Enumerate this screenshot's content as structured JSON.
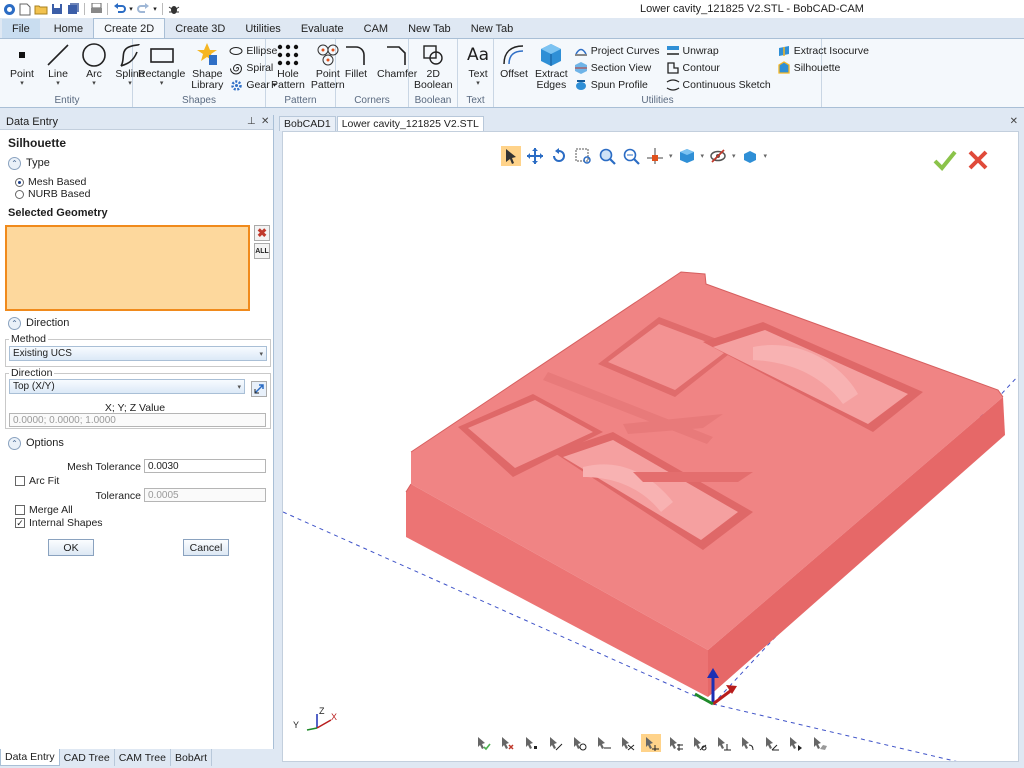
{
  "window": {
    "title": "Lower cavity_121825  V2.STL - BobCAD-CAM"
  },
  "ribbon_tabs": [
    "File",
    "Home",
    "Create 2D",
    "Create 3D",
    "Utilities",
    "Evaluate",
    "CAM",
    "New Tab",
    "New Tab"
  ],
  "active_ribbon_tab": "Create 2D",
  "groups": {
    "entity": {
      "label": "Entity",
      "items": [
        "Point",
        "Line",
        "Arc",
        "Spline"
      ]
    },
    "shapes": {
      "label": "Shapes",
      "items": [
        "Rectangle",
        "Shape\nLibrary"
      ],
      "small": [
        "Ellipse",
        "Spiral",
        "Gear"
      ]
    },
    "pattern": {
      "label": "Pattern",
      "items": [
        "Hole\nPattern",
        "Point\nPattern"
      ]
    },
    "corners": {
      "label": "Corners",
      "items": [
        "Fillet",
        "Chamfer"
      ]
    },
    "boolean": {
      "label": "Boolean",
      "items": [
        "2D\nBoolean"
      ]
    },
    "text": {
      "label": "Text",
      "items": [
        "Text"
      ]
    },
    "utilities": {
      "label": "Utilities",
      "items": [
        "Offset",
        "Extract\nEdges"
      ],
      "small": [
        "Project Curves",
        "Section View",
        "Spun Profile",
        "Unwrap",
        "Contour",
        "Continuous Sketch",
        "Extract Isocurve",
        "Silhouette"
      ]
    }
  },
  "panel": {
    "header": "Data Entry",
    "pin": "⊥",
    "close": "✕",
    "title": "Silhouette",
    "type": {
      "label": "Type",
      "options": [
        "Mesh Based",
        "NURB Based"
      ],
      "selected": "Mesh Based"
    },
    "selected_geometry_label": "Selected Geometry",
    "direction": {
      "label": "Direction",
      "method_label": "Method",
      "method_value": "Existing UCS",
      "direction_label": "Direction",
      "direction_value": "Top (X/Y)",
      "xyz_label": "X; Y; Z Value",
      "xyz_value": "0.0000; 0.0000; 1.0000"
    },
    "options": {
      "label": "Options",
      "mesh_tolerance_label": "Mesh Tolerance",
      "mesh_tolerance_value": "0.0030",
      "arc_fit_label": "Arc Fit",
      "arc_fit_checked": false,
      "tolerance_label": "Tolerance",
      "tolerance_value": "0.0005",
      "merge_all_label": "Merge All",
      "merge_all_checked": false,
      "internal_shapes_label": "Internal Shapes",
      "internal_shapes_checked": true
    },
    "ok_label": "OK",
    "cancel_label": "Cancel",
    "side_buttons": {
      "delete": "✖",
      "all": "ALL"
    }
  },
  "bottom_tabs": [
    "Data Entry",
    "CAD Tree",
    "CAM Tree",
    "BobArt"
  ],
  "doc_tabs": [
    "BobCAD1",
    "Lower cavity_121825  V2.STL"
  ],
  "active_doc_tab": "Lower cavity_121825  V2.STL",
  "doc_close": "✕",
  "colors": {
    "model": "#f08080",
    "accent": "#f08a1c",
    "selection_fill": "#fdd89d",
    "ribbon": "#f4f8fc"
  },
  "triad": {
    "y": "Y",
    "z": "Z",
    "x": "X"
  }
}
